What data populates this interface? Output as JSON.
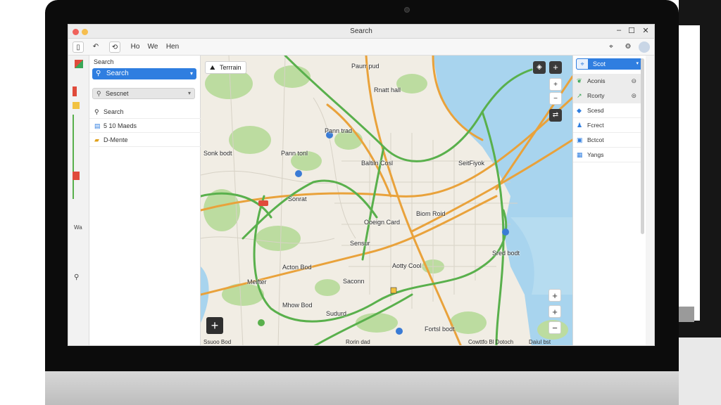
{
  "window": {
    "title": "Search"
  },
  "toolbar": {
    "items": [
      "Ho",
      "We",
      "Hen"
    ]
  },
  "rail": {
    "marks": [
      "Wa"
    ]
  },
  "left_panel": {
    "label": "Search",
    "search_value": "Search",
    "select_value": "Sescnet",
    "items": [
      {
        "label": "Search",
        "icon": "search-icon"
      },
      {
        "label": "5 10 Maeds",
        "icon": "list-icon"
      },
      {
        "label": "D-Mente",
        "icon": "folder-icon"
      }
    ]
  },
  "map": {
    "terrain_label": "Terrrain",
    "labels": [
      "Paurr pud",
      "Rnatt hall",
      "Pann trad",
      "Sonk bodt",
      "Pann tonl",
      "Baltiln Cosl",
      "SeitFiyok",
      "Sonrat",
      "Ooeign Card",
      "Biom Roid",
      "Sensur",
      "Sred bodt",
      "Acton Bod",
      "Aotty Cool",
      "Saconn",
      "Mhow Bod",
      "Sudurd",
      "Meifter",
      "Fortsl bodt"
    ],
    "attribution": [
      "Ssuoo Bod",
      "Rorin dad",
      "Cowttfo Bl Dotoch",
      "Daiul bst"
    ]
  },
  "right_panel": {
    "header": "Scot",
    "items": [
      {
        "label": "Aconis",
        "icon": "leaf-icon",
        "selected": true
      },
      {
        "label": "Rcorty",
        "icon": "route-icon",
        "selected": true
      },
      {
        "label": "Scesd",
        "icon": "layers-icon",
        "selected": false
      },
      {
        "label": "Fcrect",
        "icon": "people-icon",
        "selected": false
      },
      {
        "label": "Bctcot",
        "icon": "box-icon",
        "selected": false
      },
      {
        "label": "Yangs",
        "icon": "map-icon",
        "selected": false
      }
    ]
  },
  "colors": {
    "accent": "#2f7ee0",
    "water": "#a8d4ee",
    "park": "#bcdca0",
    "highway": "#e9a23b",
    "major_road": "#59b04c"
  }
}
